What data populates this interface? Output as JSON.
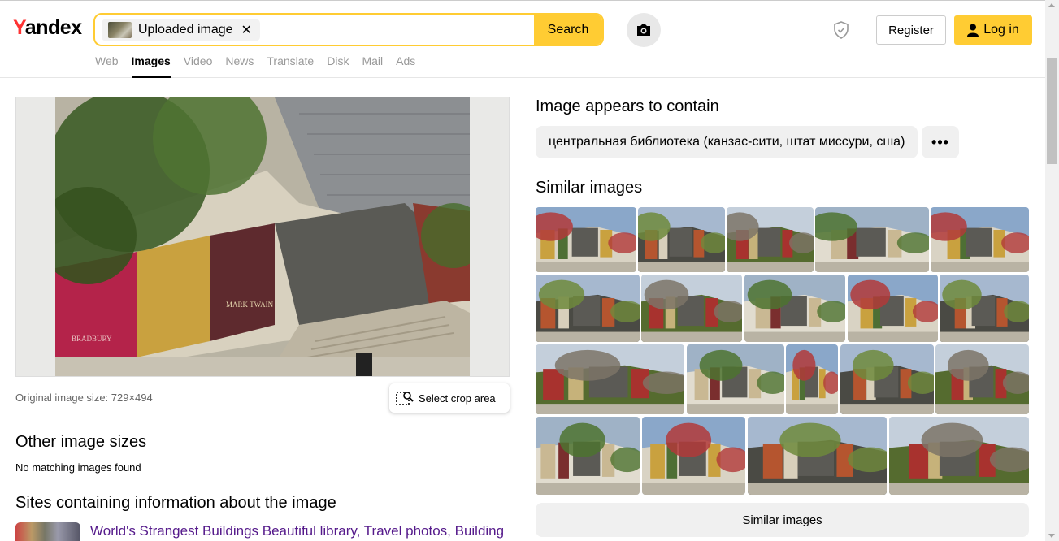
{
  "header": {
    "logo": "Yandex",
    "logo_first": "Y",
    "logo_rest": "andex",
    "chip_label": "Uploaded image",
    "chip_close": "✕",
    "search_label": "Search",
    "register_label": "Register",
    "login_label": "Log in"
  },
  "tabs": [
    {
      "label": "Web",
      "active": false
    },
    {
      "label": "Images",
      "active": true
    },
    {
      "label": "Video",
      "active": false
    },
    {
      "label": "News",
      "active": false
    },
    {
      "label": "Translate",
      "active": false
    },
    {
      "label": "Disk",
      "active": false
    },
    {
      "label": "Mail",
      "active": false
    },
    {
      "label": "Ads",
      "active": false
    }
  ],
  "left": {
    "original_size": "Original image size: 729×494",
    "crop_label": "Select crop area",
    "other_sizes_heading": "Other image sizes",
    "no_matching": "No matching images found",
    "sites_heading": "Sites containing information about the image",
    "site_link": "World's Strangest Buildings Beautiful library, Travel photos, Building"
  },
  "right": {
    "contains_heading": "Image appears to contain",
    "tag": "центральная библиотека (канзас-сити, штат миссури, сша)",
    "more": "•••",
    "similar_heading": "Similar images",
    "similar_button": "Similar images"
  },
  "colors": {
    "accent": "#ffcc33",
    "logo_red": "#ff3333",
    "link_visited": "#551a8b"
  }
}
